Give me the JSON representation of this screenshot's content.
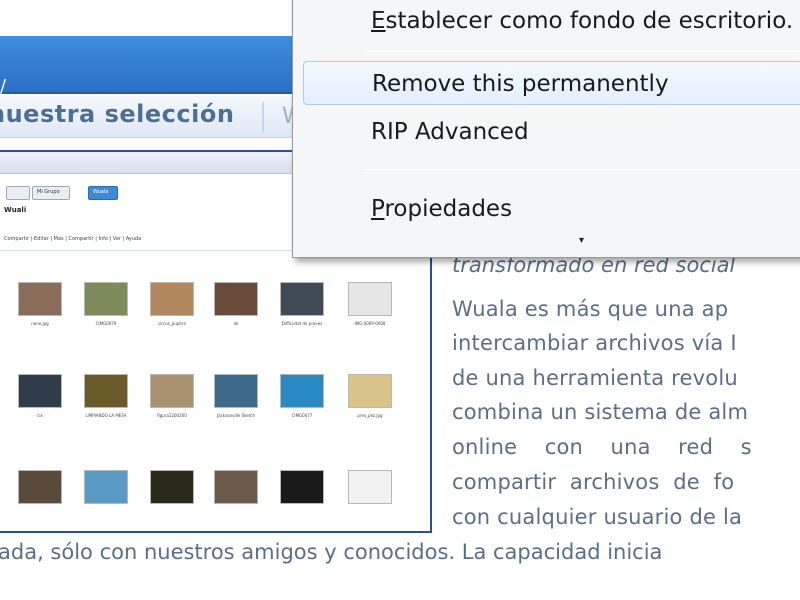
{
  "page": {
    "background_title_glyph": "/",
    "selection_label": "nuestra selección",
    "selection_tail": "W"
  },
  "thumbnail": {
    "tabs": [
      "",
      "Mi Grupo",
      "Wuala"
    ],
    "title": "Wuali",
    "toolbar": "Compartir | Editar | Mas | Compartir | Info | Ver | Ayuda",
    "items": [
      {
        "cap": "nene.jpg",
        "sub": "",
        "color": "#8a6c5a"
      },
      {
        "cap": "CIMG0079",
        "sub": "",
        "color": "#7d8a5a"
      },
      {
        "cap": "circus_pupitre",
        "sub": "",
        "color": "#b2875e"
      },
      {
        "cap": "ok",
        "sub": "",
        "color": "#6a4a3a"
      },
      {
        "cap": "Difficultat de proves",
        "sub": "",
        "color": "#3f4a55"
      },
      {
        "cap": "IMG-0009-0008",
        "sub": "",
        "color": "#e6e6e6"
      },
      {
        "cap": "clx",
        "sub": "",
        "color": "#2f3c4a"
      },
      {
        "cap": "LIMPIANDO LA MESA",
        "sub": "",
        "color": "#6a5a2a"
      },
      {
        "cap": "figura1200200",
        "sub": "",
        "color": "#a89270"
      },
      {
        "cap": "Jacksonville Sketch",
        "sub": "",
        "color": "#3d6a8a"
      },
      {
        "cap": "CIMG0077",
        "sub": "",
        "color": "#2a8ac4"
      },
      {
        "cap": "pres_pez.jpg",
        "sub": "",
        "color": "#d9c48a"
      },
      {
        "cap": "",
        "sub": "",
        "color": "#5a4a3a"
      },
      {
        "cap": "",
        "sub": "",
        "color": "#5a9ac4"
      },
      {
        "cap": "",
        "sub": "",
        "color": "#2a2a1a"
      },
      {
        "cap": "",
        "sub": "",
        "color": "#6a5a4a"
      },
      {
        "cap": "",
        "sub": "",
        "color": "#1a1a1a"
      },
      {
        "cap": "",
        "sub": "",
        "color": "#f2f2f2"
      }
    ],
    "status": ""
  },
  "article": {
    "italic_line": "transformado en red social",
    "lines": [
      "Wuala es más que una ap",
      "intercambiar archivos vía I",
      "de una herramienta revolu",
      "combina un sistema de alm",
      "online    con    una    red    s",
      "compartir  archivos  de  fo",
      "con cualquier usuario de la"
    ],
    "full_line": "ada, sólo con nuestros amigos y conocidos. La capacidad inicia"
  },
  "context_menu": {
    "items": [
      {
        "label_prefix": "",
        "label_underlined": "E",
        "label_rest": "stablecer como fondo de escritorio.",
        "hover": false
      },
      {
        "label_prefix": "",
        "label_underlined": "",
        "label_rest": "Remove this permanently",
        "hover": true
      },
      {
        "label_prefix": "",
        "label_underlined": "",
        "label_rest": "RIP Advanced",
        "hover": false
      },
      {
        "label_prefix": "",
        "label_underlined": "P",
        "label_rest": "ropiedades",
        "hover": false
      }
    ],
    "more_arrow": "▾"
  }
}
